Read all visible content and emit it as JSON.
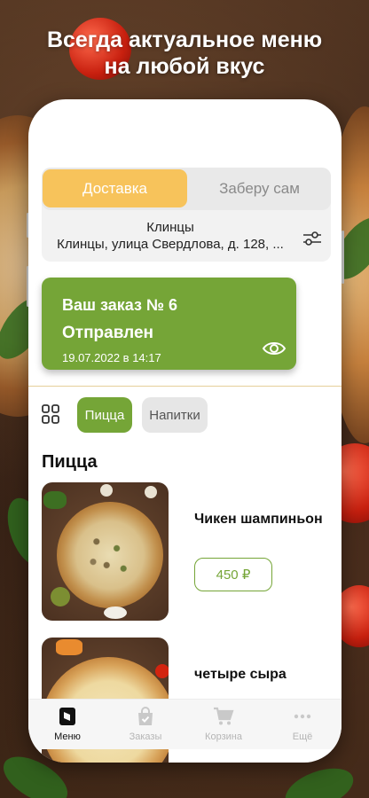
{
  "headline": "Всегда актуальное меню\nна любой вкус",
  "delivery": {
    "tabs": [
      {
        "label": "Доставка",
        "active": true
      },
      {
        "label": "Заберу сам",
        "active": false
      }
    ],
    "city": "Клинцы",
    "address": "Клинцы, улица Свердлова, д. 128, ..."
  },
  "order": {
    "title": "Ваш заказ № 6",
    "status": "Отправлен",
    "datetime": "19.07.2022 в 14:17"
  },
  "categories": [
    {
      "label": "Пицца",
      "active": true
    },
    {
      "label": "Напитки",
      "active": false
    }
  ],
  "section_title": "Пицца",
  "products": [
    {
      "name": "Чикен шампиньон",
      "price": "450 ₽"
    },
    {
      "name": "четыре сыра"
    }
  ],
  "tabbar": [
    {
      "label": "Меню",
      "icon": "menu-icon",
      "active": true
    },
    {
      "label": "Заказы",
      "icon": "orders-bag-icon",
      "active": false
    },
    {
      "label": "Корзина",
      "icon": "cart-icon",
      "active": false
    },
    {
      "label": "Ещё",
      "icon": "more-dots-icon",
      "active": false
    }
  ],
  "colors": {
    "accent_green": "#75a537",
    "delivery_yellow": "#f7c35b",
    "divider": "#e5cf9a"
  }
}
